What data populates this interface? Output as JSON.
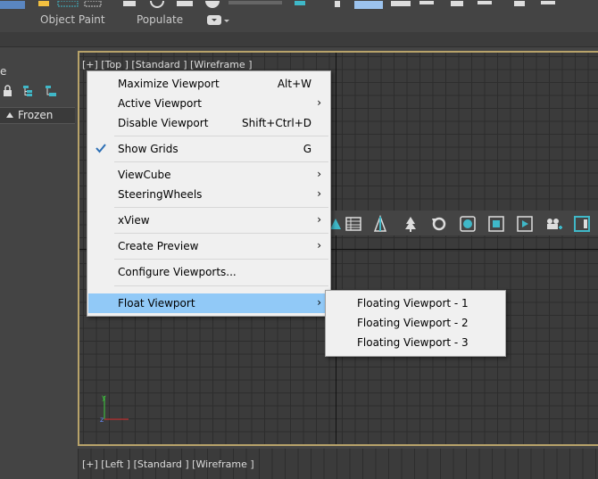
{
  "ribbon": {
    "object_paint": "Object Paint",
    "populate": "Populate"
  },
  "left_panel": {
    "title_fragment": "e",
    "frozen_label": "Frozen"
  },
  "viewport_top": {
    "label": "[+] [Top ] [Standard ] [Wireframe ]"
  },
  "viewport_left": {
    "label": "[+] [Left ] [Standard ] [Wireframe ]"
  },
  "axis": {
    "y": "y",
    "z": "z"
  },
  "context_menu": {
    "items": [
      {
        "label": "Maximize Viewport",
        "shortcut": "Alt+W"
      },
      {
        "label": "Active Viewport",
        "arrow": "›"
      },
      {
        "label": "Disable Viewport",
        "shortcut": "Shift+Ctrl+D"
      },
      {
        "label": "Show Grids",
        "shortcut": "G",
        "checked": true
      },
      {
        "label": "ViewCube",
        "arrow": "›"
      },
      {
        "label": "SteeringWheels",
        "arrow": "›"
      },
      {
        "label": "xView",
        "arrow": "›"
      },
      {
        "label": "Create Preview",
        "arrow": "›"
      },
      {
        "label": "Configure Viewports..."
      },
      {
        "label": "Float Viewport",
        "arrow": "›",
        "highlighted": true
      }
    ]
  },
  "float_submenu": {
    "items": [
      {
        "label": "Floating Viewport - 1"
      },
      {
        "label": "Floating Viewport - 2"
      },
      {
        "label": "Floating Viewport - 3"
      }
    ]
  },
  "colors": {
    "highlight": "#91c9f7",
    "viewport_border": "#b8a36a",
    "accent_teal": "#3fb8c8"
  },
  "icons": [
    "sort-icon",
    "hierarchy-icon",
    "lock-icon",
    "table-icon",
    "tree-icon",
    "light-icon",
    "refresh-icon",
    "render-icon",
    "frame-icon",
    "play-icon",
    "camera-icon"
  ]
}
